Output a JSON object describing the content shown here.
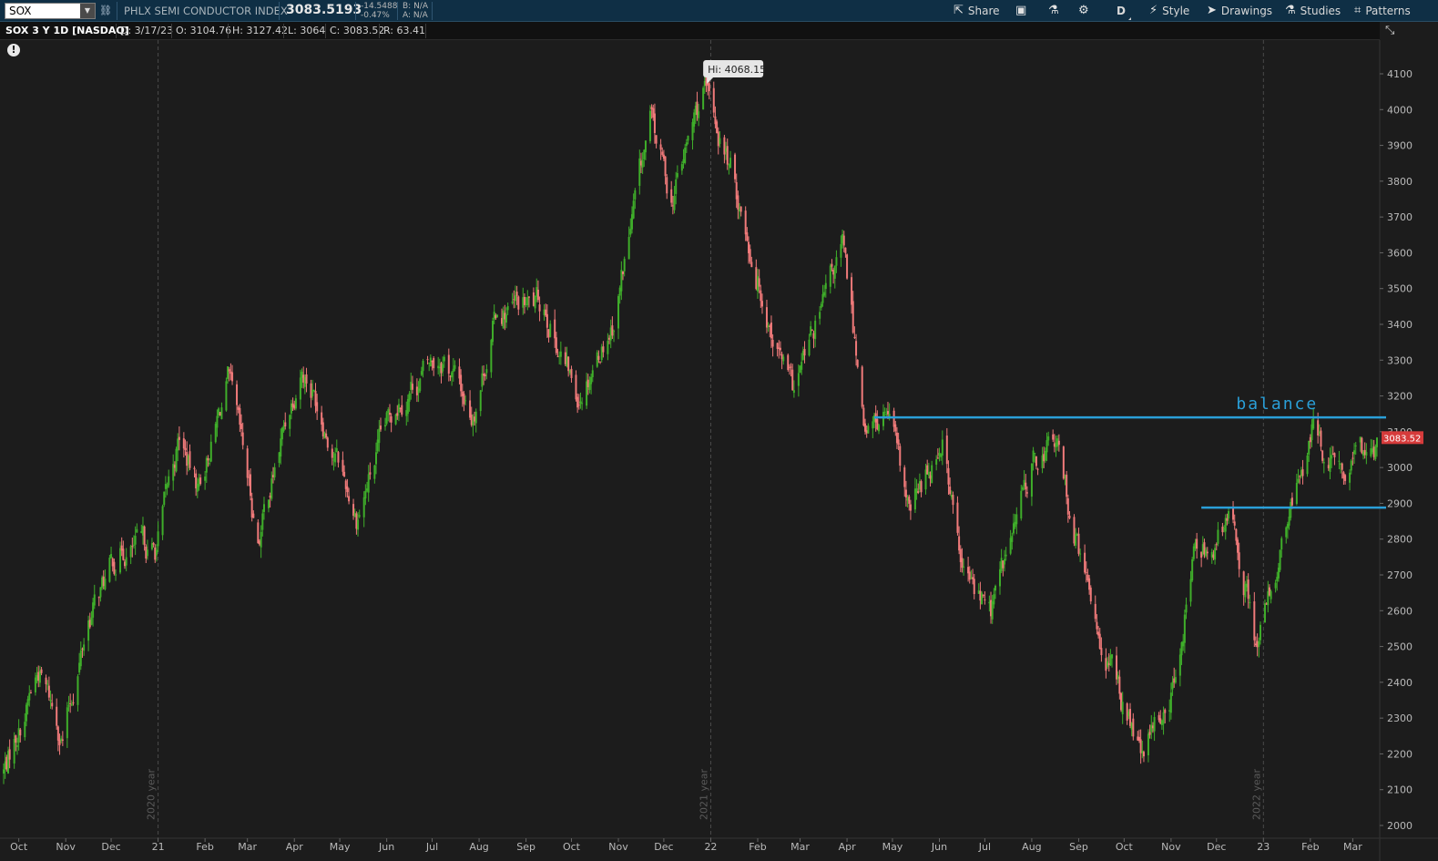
{
  "toolbar": {
    "symbol": "SOX",
    "instrument_name": "PHLX SEMI CONDUCTOR INDEX",
    "last_price": "3083.5193",
    "net_change": "-14.5488",
    "pct_change": "-0.47%",
    "bid": "B: N/A",
    "ask": "A: N/A",
    "share_label": "Share",
    "aggregation_label": "D",
    "style_label": "Style",
    "drawings_label": "Drawings",
    "studies_label": "Studies",
    "patterns_label": "Patterns"
  },
  "info_bar": {
    "title": "SOX 3 Y 1D [NASDAQ]",
    "date": "D: 3/17/23",
    "open": "O: 3104.76",
    "high": "H: 3127.42",
    "low": "L: 3064",
    "close": "C: 3083.52",
    "range": "R: 63.41"
  },
  "annotations": {
    "balance_label": "balance",
    "hi_bubble": "Hi: 4068.15",
    "current_price_tag": "3083.52"
  },
  "colors": {
    "up": "#3fae2a",
    "down": "#f07a7a",
    "level_lines": "#2a9fd8",
    "price_tag": "#d63b3b"
  },
  "chart_data": {
    "type": "candlestick",
    "title": "SOX 3 Y 1D [NASDAQ]",
    "interval": "1 day",
    "ylim": [
      1960,
      4160
    ],
    "y_ticks": [
      2000,
      2100,
      2200,
      2300,
      2400,
      2500,
      2600,
      2700,
      2800,
      2900,
      3000,
      3100,
      3200,
      3300,
      3400,
      3500,
      3600,
      3700,
      3800,
      3900,
      4000,
      4100
    ],
    "x_tick_labels": [
      "Oct",
      "Nov",
      "Dec",
      "21",
      "Feb",
      "Mar",
      "Apr",
      "May",
      "Jun",
      "Jul",
      "Aug",
      "Sep",
      "Oct",
      "Nov",
      "Dec",
      "22",
      "Feb",
      "Mar",
      "Apr",
      "May",
      "Jun",
      "Jul",
      "Aug",
      "Sep",
      "Oct",
      "Nov",
      "Dec",
      "23",
      "Feb",
      "Mar"
    ],
    "x_tick_dates": [
      "2020-10-01",
      "2020-11-01",
      "2020-12-01",
      "2021-01-01",
      "2021-02-01",
      "2021-03-01",
      "2021-04-01",
      "2021-05-01",
      "2021-06-01",
      "2021-07-01",
      "2021-08-01",
      "2021-09-01",
      "2021-10-01",
      "2021-11-01",
      "2021-12-01",
      "2022-01-01",
      "2022-02-01",
      "2022-03-01",
      "2022-04-01",
      "2022-05-01",
      "2022-06-01",
      "2022-07-01",
      "2022-08-01",
      "2022-09-01",
      "2022-10-01",
      "2022-11-01",
      "2022-12-01",
      "2023-01-01",
      "2023-02-01",
      "2023-03-01"
    ],
    "year_markers": [
      {
        "date": "2021-01-01",
        "label": "2020 year"
      },
      {
        "date": "2022-01-01",
        "label": "2021 year"
      },
      {
        "date": "2023-01-01",
        "label": "2022 year"
      }
    ],
    "close_path": [
      {
        "date": "2020-09-21",
        "close": 2150
      },
      {
        "date": "2020-10-14",
        "close": 2430
      },
      {
        "date": "2020-10-30",
        "close": 2250
      },
      {
        "date": "2020-11-16",
        "close": 2580
      },
      {
        "date": "2020-12-08",
        "close": 2780
      },
      {
        "date": "2020-12-30",
        "close": 2760
      },
      {
        "date": "2021-01-15",
        "close": 3080
      },
      {
        "date": "2021-01-27",
        "close": 2940
      },
      {
        "date": "2021-02-16",
        "close": 3230
      },
      {
        "date": "2021-03-08",
        "close": 2800
      },
      {
        "date": "2021-04-05",
        "close": 3300
      },
      {
        "date": "2021-04-20",
        "close": 3150
      },
      {
        "date": "2021-05-12",
        "close": 2870
      },
      {
        "date": "2021-06-09",
        "close": 3200
      },
      {
        "date": "2021-07-09",
        "close": 3320
      },
      {
        "date": "2021-07-27",
        "close": 3150
      },
      {
        "date": "2021-08-13",
        "close": 3440
      },
      {
        "date": "2021-09-14",
        "close": 3450
      },
      {
        "date": "2021-10-04",
        "close": 3200
      },
      {
        "date": "2021-10-29",
        "close": 3420
      },
      {
        "date": "2021-11-22",
        "close": 3960
      },
      {
        "date": "2021-12-06",
        "close": 3750
      },
      {
        "date": "2021-12-27",
        "close": 4050
      },
      {
        "date": "2022-01-11",
        "close": 3880
      },
      {
        "date": "2022-02-08",
        "close": 3430
      },
      {
        "date": "2022-02-24",
        "close": 3200
      },
      {
        "date": "2022-03-29",
        "close": 3600
      },
      {
        "date": "2022-04-14",
        "close": 3100
      },
      {
        "date": "2022-04-28",
        "close": 3150
      },
      {
        "date": "2022-05-12",
        "close": 2850
      },
      {
        "date": "2022-06-03",
        "close": 3100
      },
      {
        "date": "2022-06-16",
        "close": 2700
      },
      {
        "date": "2022-07-05",
        "close": 2600
      },
      {
        "date": "2022-08-01",
        "close": 3000
      },
      {
        "date": "2022-08-16",
        "close": 3080
      },
      {
        "date": "2022-09-07",
        "close": 2650
      },
      {
        "date": "2022-10-13",
        "close": 2180
      },
      {
        "date": "2022-11-04",
        "close": 2400
      },
      {
        "date": "2022-11-15",
        "close": 2750
      },
      {
        "date": "2022-12-13",
        "close": 2850
      },
      {
        "date": "2022-12-28",
        "close": 2500
      },
      {
        "date": "2023-01-18",
        "close": 2850
      },
      {
        "date": "2023-02-02",
        "close": 3100
      },
      {
        "date": "2023-02-22",
        "close": 2950
      },
      {
        "date": "2023-03-17",
        "close": 3083.52
      }
    ],
    "high_marker": {
      "label": "Hi: 4068.15",
      "date": "2021-12-27",
      "value": 4068.15
    },
    "horizontal_lines": [
      {
        "value": 3140,
        "start_date": "2022-04-19",
        "end_date": "2023-03-17",
        "label": "balance"
      },
      {
        "value": 2888,
        "start_date": "2022-11-21",
        "end_date": "2023-03-17",
        "label": ""
      }
    ],
    "last_close": 3083.52
  }
}
